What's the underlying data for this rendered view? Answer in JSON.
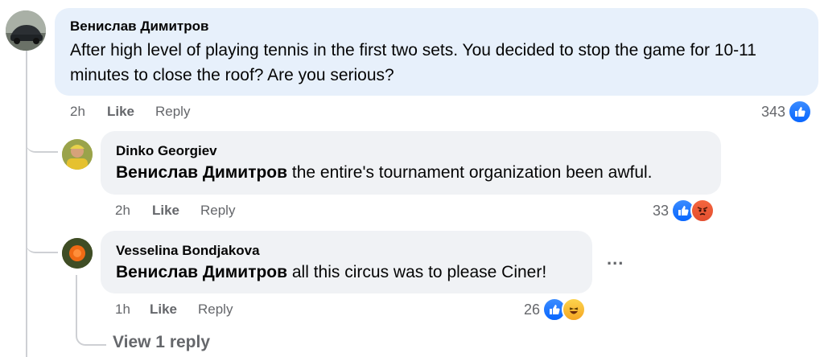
{
  "comments": [
    {
      "author": "Венислав Димитров",
      "text": "After high level of playing tennis in the first two sets. You decided to stop the game for 10-11 minutes to close the roof? Are you serious?",
      "time": "2h",
      "like_label": "Like",
      "reply_label": "Reply",
      "reaction_count": "343",
      "reactions": [
        "like-icon"
      ]
    },
    {
      "author": "Dinko Georgiev",
      "mention": "Венислав Димитров",
      "text": " the entire's tournament organization been awful.",
      "time": "2h",
      "like_label": "Like",
      "reply_label": "Reply",
      "reaction_count": "33",
      "reactions": [
        "like-icon",
        "angry-icon"
      ]
    },
    {
      "author": "Vesselina Bondjakova",
      "mention": "Венислав Димитров",
      "text": " all this circus was to please Ciner!",
      "time": "1h",
      "like_label": "Like",
      "reply_label": "Reply",
      "reaction_count": "26",
      "reactions": [
        "like-icon",
        "haha-icon"
      ]
    }
  ],
  "more_options": "...",
  "view_replies": "View 1 reply",
  "colors": {
    "like": "#0866ff",
    "bubble_main": "#e7f0fb",
    "bubble": "#f0f2f5",
    "meta": "#65676b"
  }
}
